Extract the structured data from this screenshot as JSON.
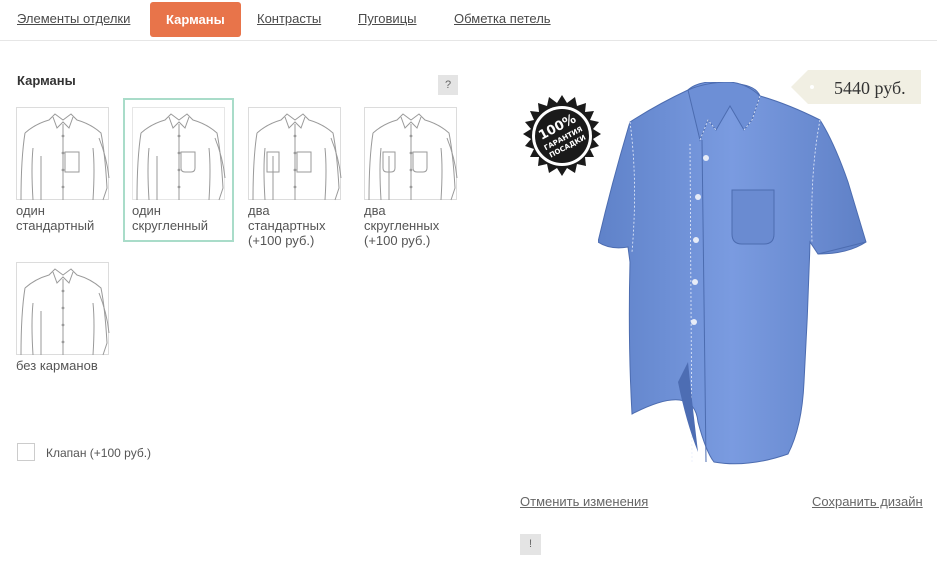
{
  "tabs": [
    {
      "label": "Элементы отделки"
    },
    {
      "label": "Карманы"
    },
    {
      "label": "Контрасты"
    },
    {
      "label": "Пуговицы"
    },
    {
      "label": "Обметка петель"
    }
  ],
  "active_tab": "Карманы",
  "section": {
    "title": "Карманы",
    "help_label": "?"
  },
  "pocket_options": [
    {
      "label": "один стандартный",
      "selected": false
    },
    {
      "label": "один скругленный",
      "selected": true
    },
    {
      "label": "два стандартных (+100 руб.)",
      "selected": false
    },
    {
      "label": "два скругленных (+100 руб.)",
      "selected": false
    },
    {
      "label": "без карманов",
      "selected": false
    }
  ],
  "flap": {
    "label": "Клапан (+100 руб.)",
    "checked": false
  },
  "price": "5440 руб.",
  "badge": {
    "line1": "100%",
    "line2": "ГАРАНТИЯ",
    "line3": "ПОСАДКИ"
  },
  "actions": {
    "cancel": "Отменить изменения",
    "save": "Сохранить дизайн",
    "info": "!"
  },
  "colors": {
    "accent": "#e8744a",
    "selected_border": "#a9dcc9",
    "shirt": "#7193d6"
  }
}
